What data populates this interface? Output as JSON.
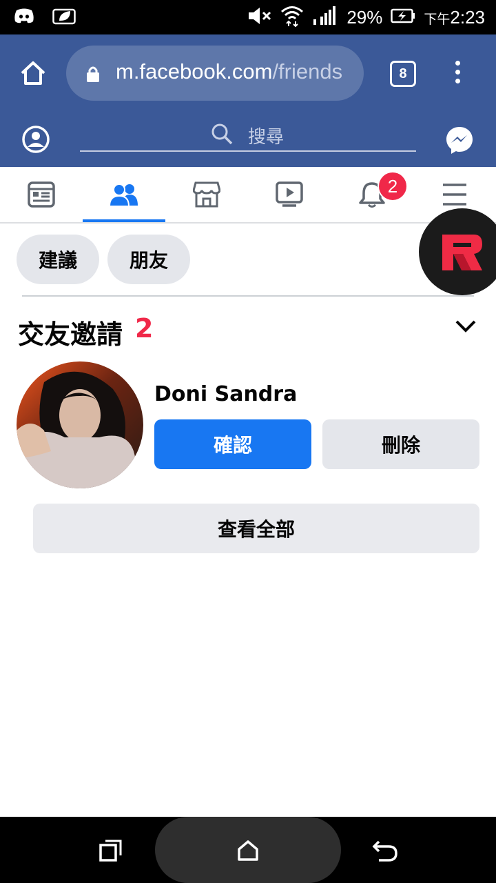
{
  "status_bar": {
    "battery_percent": "29%",
    "time_prefix": "下午",
    "time": "2:23"
  },
  "browser": {
    "url_main": "m.facebook.com",
    "url_rest": "/friends",
    "tab_count": "8"
  },
  "fb_header": {
    "search_placeholder": "搜尋"
  },
  "nav": {
    "items": [
      "news-feed",
      "friends",
      "marketplace",
      "watch",
      "notifications",
      "menu"
    ],
    "active": "friends",
    "notification_count": "2"
  },
  "chips": [
    "建議",
    "朋友"
  ],
  "requests": {
    "title": "交友邀請",
    "count": "2",
    "items": [
      {
        "name": "Doni Sandra",
        "confirm_label": "確認",
        "delete_label": "刪除"
      }
    ],
    "see_all_label": "查看全部"
  },
  "colors": {
    "brand_blue": "#3b5998",
    "primary_button": "#1877f2",
    "badge_red": "#f02849"
  }
}
